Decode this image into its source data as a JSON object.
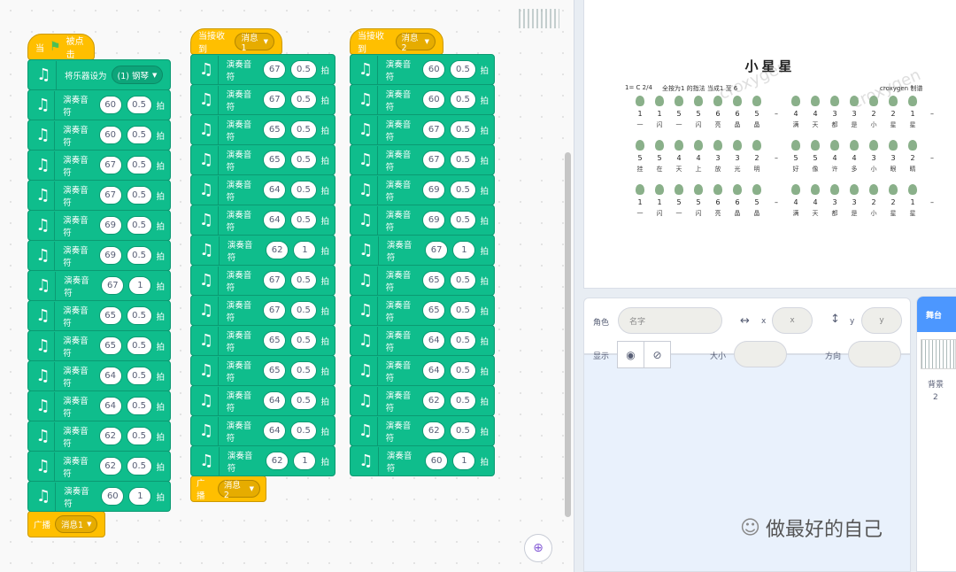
{
  "script1": {
    "hat_prefix": "当",
    "hat_suffix": "被点击",
    "set_instrument_label": "将乐器设为",
    "instrument_value": "(1) 钢琴",
    "notes": [
      {
        "label": "演奏音符",
        "note": "60",
        "beats": "0.5",
        "unit": "拍"
      },
      {
        "label": "演奏音符",
        "note": "60",
        "beats": "0.5",
        "unit": "拍"
      },
      {
        "label": "演奏音符",
        "note": "67",
        "beats": "0.5",
        "unit": "拍"
      },
      {
        "label": "演奏音符",
        "note": "67",
        "beats": "0.5",
        "unit": "拍"
      },
      {
        "label": "演奏音符",
        "note": "69",
        "beats": "0.5",
        "unit": "拍"
      },
      {
        "label": "演奏音符",
        "note": "69",
        "beats": "0.5",
        "unit": "拍"
      },
      {
        "label": "演奏音符",
        "note": "67",
        "beats": "1",
        "unit": "拍"
      },
      {
        "label": "演奏音符",
        "note": "65",
        "beats": "0.5",
        "unit": "拍"
      },
      {
        "label": "演奏音符",
        "note": "65",
        "beats": "0.5",
        "unit": "拍"
      },
      {
        "label": "演奏音符",
        "note": "64",
        "beats": "0.5",
        "unit": "拍"
      },
      {
        "label": "演奏音符",
        "note": "64",
        "beats": "0.5",
        "unit": "拍"
      },
      {
        "label": "演奏音符",
        "note": "62",
        "beats": "0.5",
        "unit": "拍"
      },
      {
        "label": "演奏音符",
        "note": "62",
        "beats": "0.5",
        "unit": "拍"
      },
      {
        "label": "演奏音符",
        "note": "60",
        "beats": "1",
        "unit": "拍"
      }
    ],
    "broadcast_label": "广播",
    "broadcast_value": "消息1"
  },
  "script2": {
    "hat_label": "当接收到",
    "hat_value": "消息1",
    "notes": [
      {
        "label": "演奏音符",
        "note": "67",
        "beats": "0.5",
        "unit": "拍"
      },
      {
        "label": "演奏音符",
        "note": "67",
        "beats": "0.5",
        "unit": "拍"
      },
      {
        "label": "演奏音符",
        "note": "65",
        "beats": "0.5",
        "unit": "拍"
      },
      {
        "label": "演奏音符",
        "note": "65",
        "beats": "0.5",
        "unit": "拍"
      },
      {
        "label": "演奏音符",
        "note": "64",
        "beats": "0.5",
        "unit": "拍"
      },
      {
        "label": "演奏音符",
        "note": "64",
        "beats": "0.5",
        "unit": "拍"
      },
      {
        "label": "演奏音符",
        "note": "62",
        "beats": "1",
        "unit": "拍"
      },
      {
        "label": "演奏音符",
        "note": "67",
        "beats": "0.5",
        "unit": "拍"
      },
      {
        "label": "演奏音符",
        "note": "67",
        "beats": "0.5",
        "unit": "拍"
      },
      {
        "label": "演奏音符",
        "note": "65",
        "beats": "0.5",
        "unit": "拍"
      },
      {
        "label": "演奏音符",
        "note": "65",
        "beats": "0.5",
        "unit": "拍"
      },
      {
        "label": "演奏音符",
        "note": "64",
        "beats": "0.5",
        "unit": "拍"
      },
      {
        "label": "演奏音符",
        "note": "64",
        "beats": "0.5",
        "unit": "拍"
      },
      {
        "label": "演奏音符",
        "note": "62",
        "beats": "1",
        "unit": "拍"
      }
    ],
    "broadcast_label": "广播",
    "broadcast_value": "消息2"
  },
  "script3": {
    "hat_label": "当接收到",
    "hat_value": "消息2",
    "notes": [
      {
        "label": "演奏音符",
        "note": "60",
        "beats": "0.5",
        "unit": "拍"
      },
      {
        "label": "演奏音符",
        "note": "60",
        "beats": "0.5",
        "unit": "拍"
      },
      {
        "label": "演奏音符",
        "note": "67",
        "beats": "0.5",
        "unit": "拍"
      },
      {
        "label": "演奏音符",
        "note": "67",
        "beats": "0.5",
        "unit": "拍"
      },
      {
        "label": "演奏音符",
        "note": "69",
        "beats": "0.5",
        "unit": "拍"
      },
      {
        "label": "演奏音符",
        "note": "69",
        "beats": "0.5",
        "unit": "拍"
      },
      {
        "label": "演奏音符",
        "note": "67",
        "beats": "1",
        "unit": "拍"
      },
      {
        "label": "演奏音符",
        "note": "65",
        "beats": "0.5",
        "unit": "拍"
      },
      {
        "label": "演奏音符",
        "note": "65",
        "beats": "0.5",
        "unit": "拍"
      },
      {
        "label": "演奏音符",
        "note": "64",
        "beats": "0.5",
        "unit": "拍"
      },
      {
        "label": "演奏音符",
        "note": "64",
        "beats": "0.5",
        "unit": "拍"
      },
      {
        "label": "演奏音符",
        "note": "62",
        "beats": "0.5",
        "unit": "拍"
      },
      {
        "label": "演奏音符",
        "note": "62",
        "beats": "0.5",
        "unit": "拍"
      },
      {
        "label": "演奏音符",
        "note": "60",
        "beats": "1",
        "unit": "拍"
      }
    ]
  },
  "stage": {
    "title": "小星星",
    "key": "1= C",
    "time_sig": "2/4",
    "tempo_note": "全按为1 的指法  当成1 至 6",
    "author": "croxygen 制谱",
    "rows": [
      {
        "notes": [
          "1",
          "1",
          "5",
          "5",
          "6",
          "6",
          "5",
          "–",
          "4",
          "4",
          "3",
          "3",
          "2",
          "2",
          "1",
          "–"
        ],
        "lyrics": [
          "一",
          "闪",
          "一",
          "闪",
          "亮",
          "晶",
          "晶",
          "",
          "满",
          "天",
          "都",
          "是",
          "小",
          "星",
          "星",
          ""
        ]
      },
      {
        "notes": [
          "5",
          "5",
          "4",
          "4",
          "3",
          "3",
          "2",
          "–",
          "5",
          "5",
          "4",
          "4",
          "3",
          "3",
          "2",
          "–"
        ],
        "lyrics": [
          "挂",
          "在",
          "天",
          "上",
          "放",
          "光",
          "明",
          "",
          "好",
          "像",
          "许",
          "多",
          "小",
          "眼",
          "睛",
          ""
        ]
      },
      {
        "notes": [
          "1",
          "1",
          "5",
          "5",
          "6",
          "6",
          "5",
          "–",
          "4",
          "4",
          "3",
          "3",
          "2",
          "2",
          "1",
          "–"
        ],
        "lyrics": [
          "一",
          "闪",
          "一",
          "闪",
          "亮",
          "晶",
          "晶",
          "",
          "满",
          "天",
          "都",
          "是",
          "小",
          "星",
          "星",
          ""
        ]
      }
    ]
  },
  "sprite": {
    "sprite_label": "角色",
    "name_placeholder": "名字",
    "x_label": "x",
    "x_placeholder": "x",
    "y_label": "y",
    "y_placeholder": "y",
    "show_label": "显示",
    "size_label": "大小",
    "direction_label": "方向"
  },
  "stage_tab": {
    "label": "舞台",
    "backdrop_label": "背景",
    "backdrop_count": "2"
  },
  "wechat": {
    "text": "做最好的自己"
  }
}
